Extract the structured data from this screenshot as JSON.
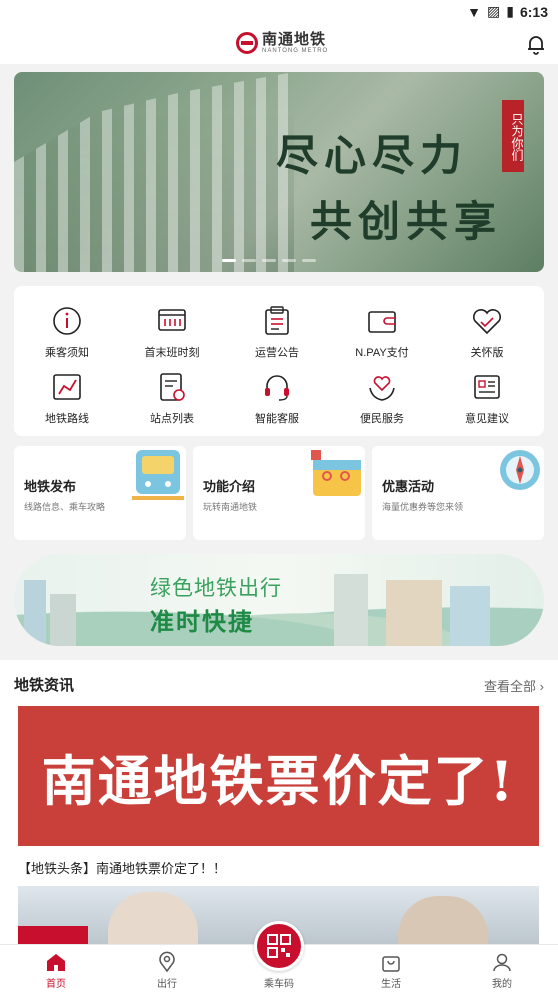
{
  "status": {
    "time": "6:13"
  },
  "header": {
    "logo_cn": "南通地铁",
    "logo_en": "NANTONG METRO"
  },
  "banner": {
    "slogan_line1": "尽心尽力",
    "slogan_line2": "共创共享",
    "seal": "只为你们",
    "slides": 5,
    "active_slide": 1
  },
  "grid": [
    {
      "label": "乘客须知",
      "icon": "info-icon"
    },
    {
      "label": "首末班时刻",
      "icon": "timetable-icon"
    },
    {
      "label": "运营公告",
      "icon": "announcement-icon"
    },
    {
      "label": "N.PAY支付",
      "icon": "wallet-icon"
    },
    {
      "label": "关怀版",
      "icon": "heart-icon"
    },
    {
      "label": "地铁路线",
      "icon": "route-map-icon"
    },
    {
      "label": "站点列表",
      "icon": "station-list-icon"
    },
    {
      "label": "智能客服",
      "icon": "headset-icon"
    },
    {
      "label": "便民服务",
      "icon": "care-hands-icon"
    },
    {
      "label": "意见建议",
      "icon": "feedback-icon"
    }
  ],
  "cards": [
    {
      "title": "地铁发布",
      "subtitle": "线路信息、乘车攻略",
      "icon": "train-icon"
    },
    {
      "title": "功能介绍",
      "subtitle": "玩转南通地铁",
      "icon": "toolbox-icon"
    },
    {
      "title": "优惠活动",
      "subtitle": "海量优惠券等您来领",
      "icon": "compass-icon"
    }
  ],
  "green_banner": {
    "line1": "绿色地铁出行",
    "line2": "准时快捷"
  },
  "news": {
    "heading": "地铁资讯",
    "more": "查看全部",
    "headline_image_text": "南通地铁票价定了!",
    "caption": "【地铁头条】南通地铁票价定了！！"
  },
  "nav": [
    {
      "label": "首页",
      "icon": "home-icon",
      "active": true
    },
    {
      "label": "出行",
      "icon": "location-icon",
      "active": false
    },
    {
      "label": "乘车码",
      "icon": "qr-code-icon",
      "active": false
    },
    {
      "label": "生活",
      "icon": "shopping-bag-icon",
      "active": false
    },
    {
      "label": "我的",
      "icon": "user-icon",
      "active": false
    }
  ],
  "colors": {
    "brand": "#c8102e",
    "green": "#1e8a45"
  }
}
